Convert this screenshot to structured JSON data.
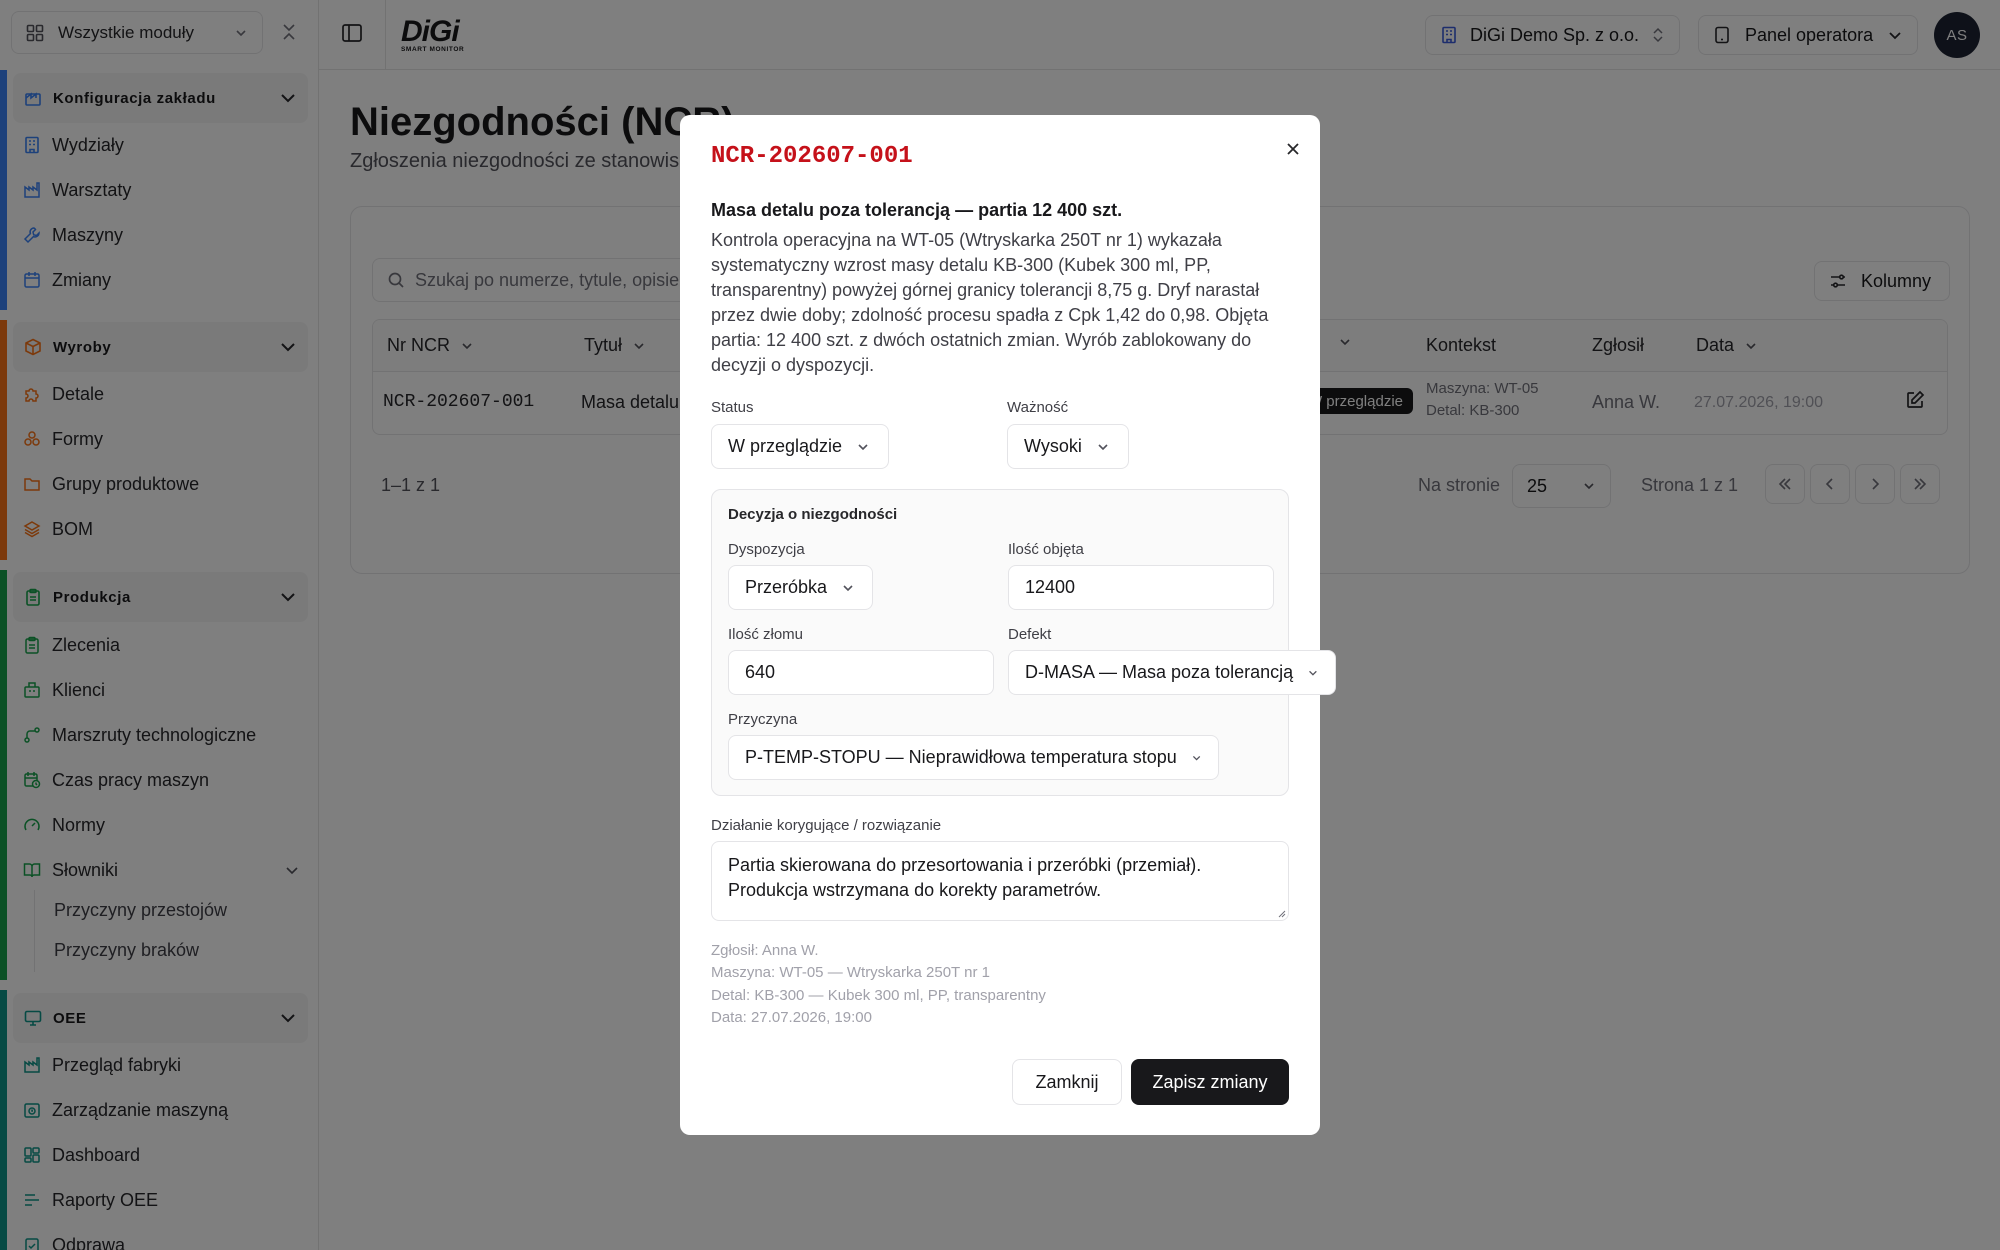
{
  "sidebar": {
    "module_select": "Wszystkie moduły",
    "sections": [
      {
        "title": "Konfiguracja zakładu",
        "color": "#3b82f6",
        "items": [
          "Wydziały",
          "Warsztaty",
          "Maszyny",
          "Zmiany"
        ]
      },
      {
        "title": "Wyroby",
        "color": "#f97316",
        "items": [
          "Detale",
          "Formy",
          "Grupy produktowe",
          "BOM"
        ]
      },
      {
        "title": "Produkcja",
        "color": "#16a34a",
        "items": [
          "Zlecenia",
          "Klienci",
          "Marszruty technologiczne",
          "Czas pracy maszyn",
          "Normy",
          "Słowniki"
        ],
        "sub_items": [
          "Przyczyny przestojów",
          "Przyczyny braków"
        ]
      },
      {
        "title": "OEE",
        "color": "#0d9488",
        "items": [
          "Przegląd fabryki",
          "Zarządzanie maszyną",
          "Dashboard",
          "Raporty OEE",
          "Odprawa"
        ]
      }
    ]
  },
  "topbar": {
    "company": "DiGi Demo Sp. z o.o.",
    "panel": "Panel operatora",
    "avatar_initials": "AS"
  },
  "page": {
    "title": "Niezgodności (NCR)",
    "subtitle": "Zgłoszenia niezgodności ze stanowisk",
    "search_placeholder": "Szukaj po numerze, tytule, opisie",
    "columns_button": "Kolumny",
    "table": {
      "headers": [
        "Nr NCR",
        "Tytuł",
        "Kontekst",
        "Zgłosił",
        "Data"
      ],
      "row": {
        "nr": "NCR-202607-001",
        "title": "Masa detalu",
        "status": "W przeglądzie",
        "context_machine": "Maszyna: WT-05",
        "context_part": "Detal: KB-300",
        "reporter": "Anna W.",
        "date": "27.07.2026, 19:00"
      }
    },
    "pagination": {
      "count": "1–1 z 1",
      "per_page_label": "Na stronie",
      "per_page_value": "25",
      "page_label": "Strona 1 z 1"
    }
  },
  "modal": {
    "id": "NCR-202607-001",
    "heading": "Masa detalu poza tolerancją — partia 12 400 szt.",
    "description": "Kontrola operacyjna na WT-05 (Wtryskarka 250T nr 1) wykazała systematyczny wzrost masy detalu KB-300 (Kubek 300 ml, PP, transparentny) powyżej górnej granicy tolerancji 8,75 g. Dryf narastał przez dwie doby; zdolność procesu spadła z Cpk 1,42 do 0,98. Objęta partia: 12 400 szt. z dwóch ostatnich zmian. Wyrób zablokowany do decyzji o dyspozycji.",
    "status_label": "Status",
    "status_value": "W przeglądzie",
    "severity_label": "Ważność",
    "severity_value": "Wysoki",
    "decision": {
      "title": "Decyzja o niezgodności",
      "disposition_label": "Dyspozycja",
      "disposition_value": "Przeróbka",
      "qty_label": "Ilość objęta",
      "qty_value": "12400",
      "scrap_label": "Ilość złomu",
      "scrap_value": "640",
      "defect_label": "Defekt",
      "defect_value": "D-MASA — Masa poza tolerancją",
      "cause_label": "Przyczyna",
      "cause_value": "P-TEMP-STOPU — Nieprawidłowa temperatura stopu"
    },
    "corrective_label": "Działanie korygujące / rozwiązanie",
    "corrective_value": "Partia skierowana do przesortowania i przeróbki (przemiał). Produkcja wstrzymana do korekty parametrów.",
    "meta": {
      "reporter": "Zgłosił: Anna W.",
      "machine": "Maszyna: WT-05 — Wtryskarka 250T nr 1",
      "part": "Detal: KB-300 — Kubek 300 ml, PP, transparentny",
      "date": "Data: 27.07.2026, 19:00"
    },
    "close_button": "Zamknij",
    "save_button": "Zapisz zmiany"
  }
}
